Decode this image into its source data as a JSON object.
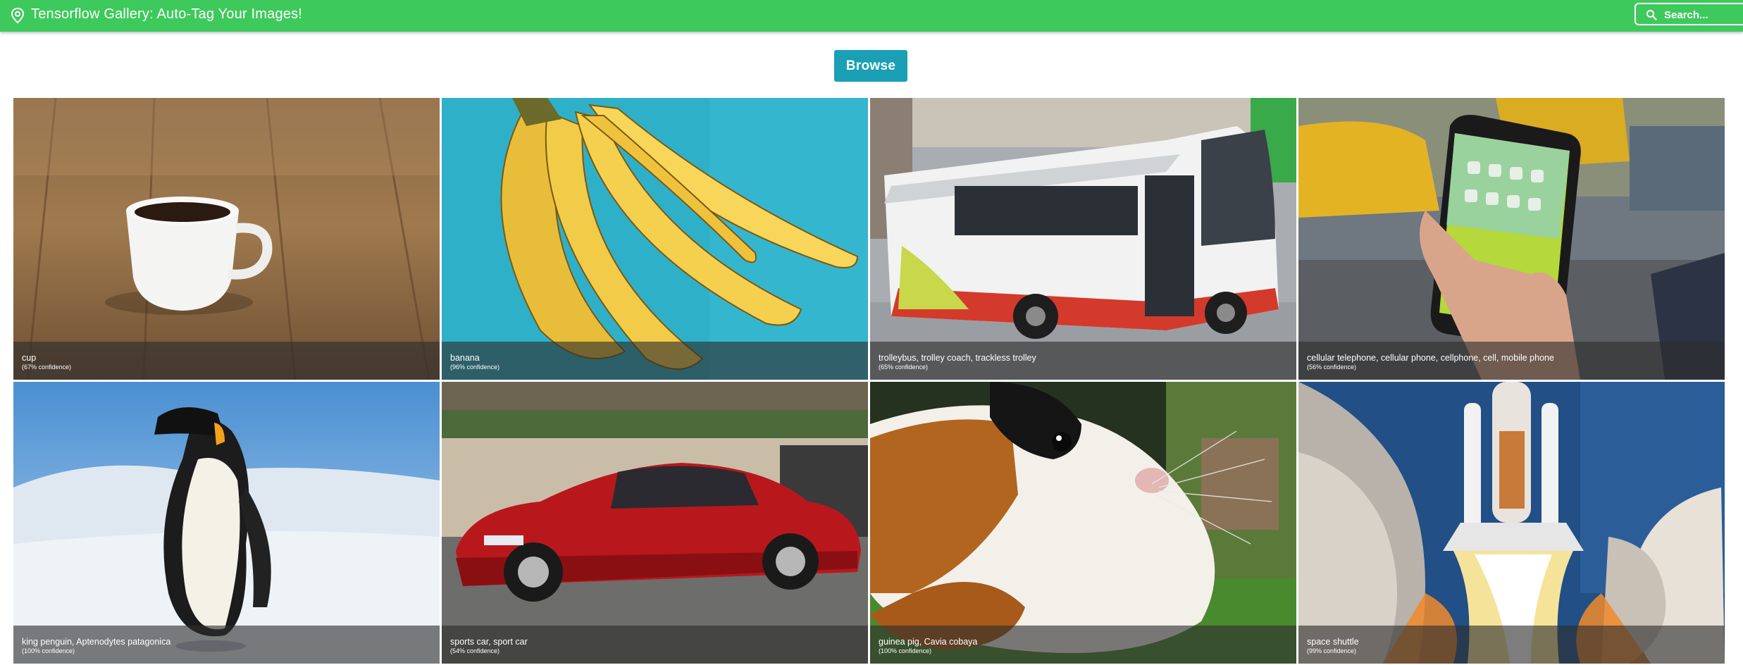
{
  "header": {
    "title": "Tensorflow Gallery: Auto-Tag Your Images!",
    "logo_icon": "map-pin-icon",
    "search": {
      "placeholder": "Search...",
      "value": "",
      "icon": "search-icon"
    },
    "bar_color": "#3ec95c"
  },
  "toolbar": {
    "browse_label": "Browse",
    "browse_color": "#1a9fb5"
  },
  "gallery": {
    "items": [
      {
        "label": "cup",
        "confidence": "(67% confidence)",
        "depicts": "white coffee cup on wooden table"
      },
      {
        "label": "banana",
        "confidence": "(96% confidence)",
        "depicts": "bunch of bananas on teal background"
      },
      {
        "label": "trolleybus, trolley coach, trackless trolley",
        "confidence": "(65% confidence)",
        "depicts": "red and white electric bus on city street"
      },
      {
        "label": "cellular telephone, cellular phone, cellphone, cell, mobile phone",
        "confidence": "(56% confidence)",
        "depicts": "hand holding smartphone with taxis behind"
      },
      {
        "label": "king penguin, Aptenodytes patagonica",
        "confidence": "(100% confidence)",
        "depicts": "penguin standing on snow"
      },
      {
        "label": "sports car, sport car",
        "confidence": "(54% confidence)",
        "depicts": "red vintage sports car"
      },
      {
        "label": "guinea pig, Cavia cobaya",
        "confidence": "(100% confidence)",
        "depicts": "tricolor guinea pig on grass"
      },
      {
        "label": "space shuttle",
        "confidence": "(99% confidence)",
        "depicts": "space shuttle launching with smoke plumes"
      }
    ]
  }
}
